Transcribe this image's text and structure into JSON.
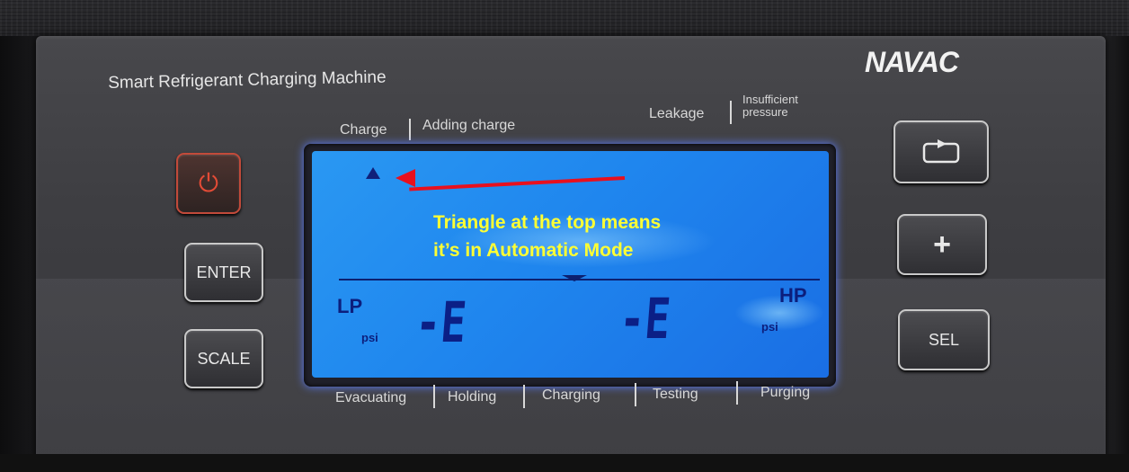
{
  "brand": "NAVAC",
  "device_title": "Smart Refrigerant Charging Machine",
  "top_labels": {
    "charge": "Charge",
    "adding_charge": "Adding charge",
    "leakage": "Leakage",
    "insufficient_line1": "Insufficient",
    "insufficient_line2": "pressure"
  },
  "buttons": {
    "enter": "ENTER",
    "scale": "SCALE",
    "plus": "+",
    "sel": "SEL"
  },
  "display": {
    "lp_label": "LP",
    "hp_label": "HP",
    "lp_unit": "psi",
    "hp_unit": "psi",
    "lp_value": "-E",
    "hp_value": "-E"
  },
  "mode_labels": [
    "Evacuating",
    "Holding",
    "Charging",
    "Testing",
    "Purging"
  ],
  "annotation": {
    "line1": "Triangle at the top means",
    "line2": "it’s in Automatic Mode",
    "color": "#ffff33",
    "arrow_color": "#e8101e"
  },
  "icons": {
    "power": "power-icon",
    "cycle": "cycle-icon",
    "automatic_mode": "automatic-mode-triangle-icon"
  }
}
